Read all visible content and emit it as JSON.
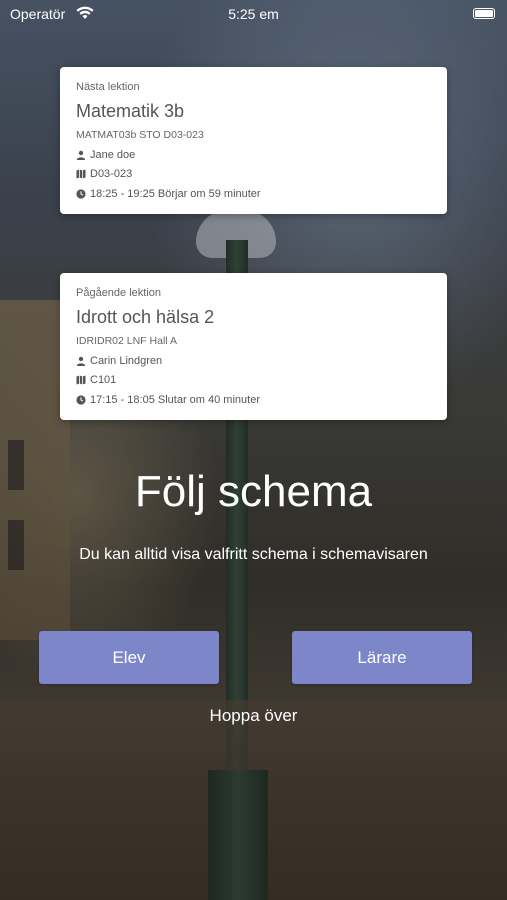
{
  "status_bar": {
    "carrier": "Operatör",
    "time": "5:25 em"
  },
  "next_lesson": {
    "kicker": "Nästa lektion",
    "title": "Matematik 3b",
    "code": "MATMAT03b STO D03-023",
    "teacher": "Jane doe",
    "room": "D03-023",
    "time_info": "18:25 - 19:25  Börjar om 59 minuter"
  },
  "current_lesson": {
    "kicker": "Pågående lektion",
    "title": "Idrott och hälsa 2",
    "code": "IDRIDR02 LNF Hall A",
    "teacher": "Carin Lindgren",
    "room": "C101",
    "time_info": "17:15 - 18:05  Slutar om 40 minuter"
  },
  "main": {
    "heading": "Följ schema",
    "subtitle": "Du kan alltid visa valfritt schema i schemavisaren",
    "student_button": "Elev",
    "teacher_button": "Lärare",
    "skip_link": "Hoppa över"
  },
  "colors": {
    "button": "#7d86c9",
    "card": "#ffffff"
  }
}
